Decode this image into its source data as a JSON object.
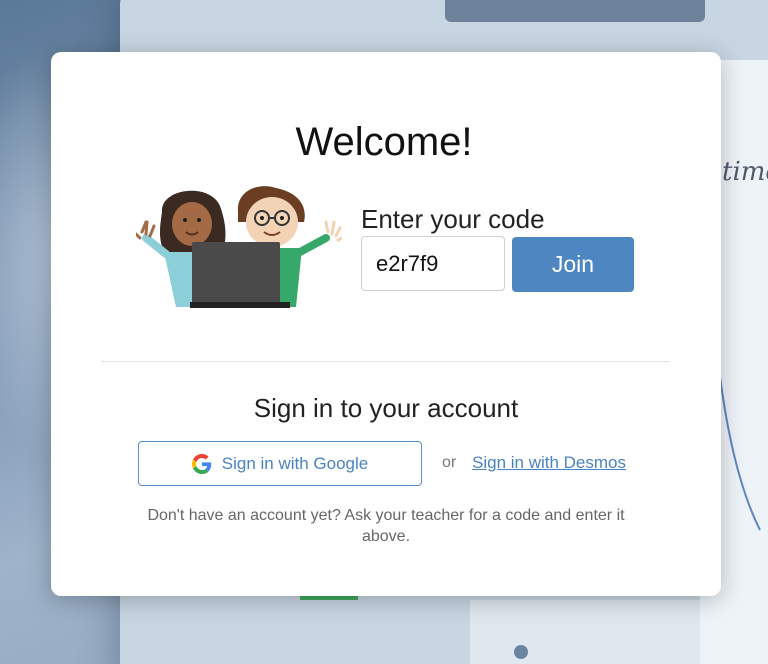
{
  "modal": {
    "title": "Welcome!",
    "code_label": "Enter your code",
    "code_value": "e2r7f9",
    "join_label": "Join",
    "signin_heading": "Sign in to your account",
    "google_label": "Sign in with Google",
    "or_text": "or",
    "desmos_label": "Sign in with Desmos",
    "help_text": "Don't have an account yet? Ask your teacher for a code and enter it above."
  },
  "background": {
    "graph_label": "time"
  },
  "colors": {
    "primary_blue": "#4e86c2",
    "link_blue": "#4a83c2"
  },
  "icons": {
    "google": "google-icon",
    "illustration": "students-with-laptop-illustration"
  }
}
